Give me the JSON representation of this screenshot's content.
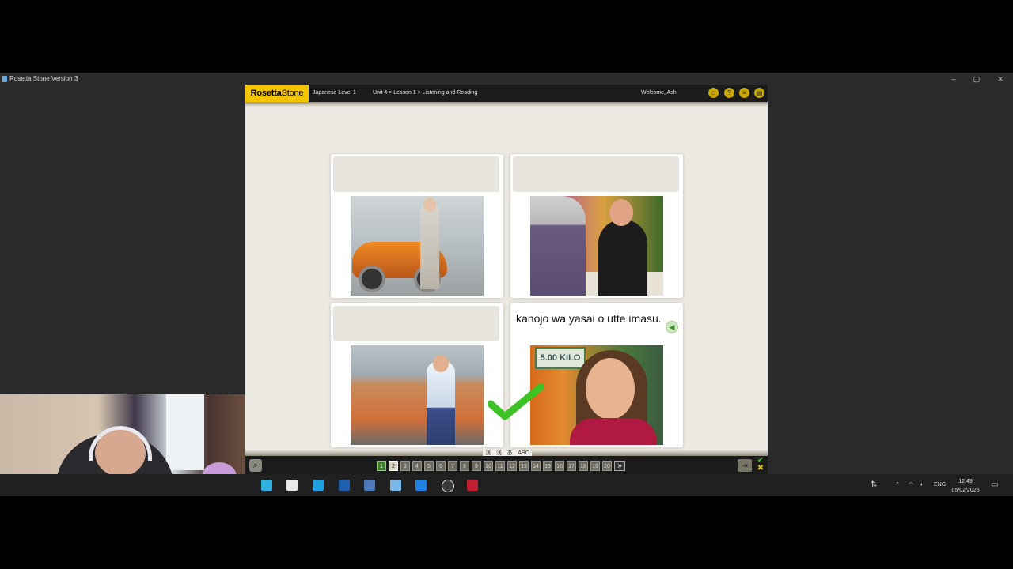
{
  "window": {
    "title": "Rosetta Stone Version 3",
    "controls": {
      "minimize": "–",
      "maximize": "▢",
      "close": "✕"
    }
  },
  "app": {
    "logo_part1": "Rosetta",
    "logo_part2": "Stone",
    "course": "Japanese Level 1",
    "breadcrumb": "Unit 4 > Lesson 1 > Listening and Reading",
    "welcome": "Welcome, Ash",
    "header_icons": [
      "home-icon",
      "help-icon",
      "menu-icon",
      "options-icon"
    ]
  },
  "cards": [
    {
      "caption": "",
      "image": "man-with-orange-car"
    },
    {
      "caption": "",
      "image": "customer-at-flower-shop"
    },
    {
      "caption": "",
      "image": "man-at-fruit-stand"
    },
    {
      "caption": "kanojo wa yasai o utte imasu.",
      "image": "girl-at-vegetable-market",
      "photo_sign": "5.00 KILO"
    }
  ],
  "result": {
    "correct_card": 4,
    "check_color": "#3cc224"
  },
  "script_options": [
    "漢",
    "あ",
    "ABC"
  ],
  "script_options_lead": "漢",
  "pager": {
    "pages": [
      "1",
      "2",
      "3",
      "4",
      "5",
      "6",
      "7",
      "8",
      "9",
      "10",
      "11",
      "12",
      "13",
      "14",
      "15",
      "16",
      "17",
      "18",
      "19",
      "20"
    ],
    "completed": 1,
    "current": 2,
    "next_label": "»"
  },
  "colors": {
    "brand": "#f5c400",
    "header": "#1b1b1b",
    "stage": "#ebe9e1"
  },
  "taskbar": {
    "language": "ENG",
    "time": "12:49",
    "date": "05/02/2026"
  }
}
